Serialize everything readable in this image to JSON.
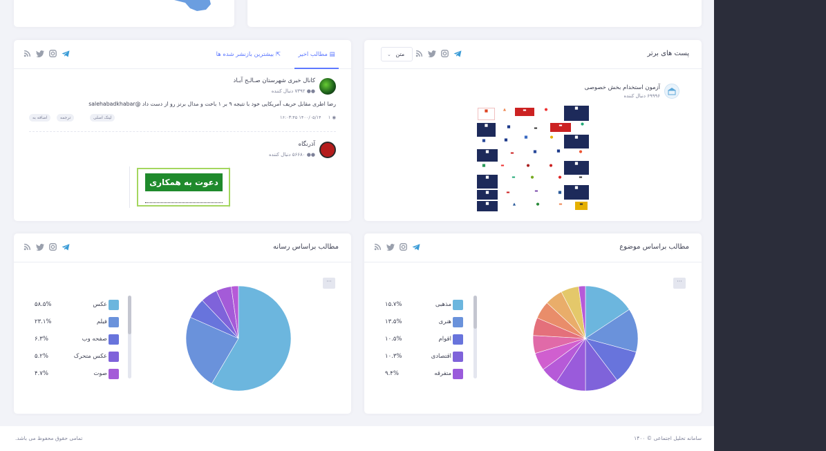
{
  "top_posts": {
    "title": "پست های برتر",
    "type_select": "متن",
    "channel_name": "آزمون استخدام بخش خصوصی",
    "followers": "۶۹۹۹۶ دنبال کننده"
  },
  "feed": {
    "tabs": [
      "مطالب اخیر",
      "بیشترین بازنشر شده ها"
    ],
    "posts": [
      {
        "channel": "کانال خبری شهرستان صـالـح آبـاد",
        "followers": "۷۳۹۲ دنبال کننده",
        "text": "رضا اطری مقابل حریف آمریکایی خود با نتیجه ۹ بر ۱ باخت و مدال برنز رو از دست داد @salehabadkhabar",
        "meta": "۱۴۰۰/۰۵/۱۴ ۱۶:۰۳:۴۵",
        "views": "۱",
        "tags": [
          "لینک اصلی",
          "ترجمه",
          "اضافه به"
        ]
      },
      {
        "channel": "آذرنگاه",
        "followers": "۵۶۶۸۰ دنبال کننده",
        "image_text": "دعوت به همکاری"
      }
    ]
  },
  "by_topic": {
    "title": "مطالب براساس موضوع",
    "menu": "···",
    "legend": [
      {
        "label": "مذهبی",
        "value": "۱۵.۷%",
        "color": "#6cb6de"
      },
      {
        "label": "هنری",
        "value": "۱۳.۵%",
        "color": "#6a92db"
      },
      {
        "label": "اقوام",
        "value": "۱۰.۵%",
        "color": "#6874dc"
      },
      {
        "label": "اقتصادی",
        "value": "۱۰.۳%",
        "color": "#7f63da"
      },
      {
        "label": "متفرقه",
        "value": "۹.۴%",
        "color": "#9a5bdb"
      }
    ]
  },
  "by_media": {
    "title": "مطالب براساس رسانه",
    "menu": "···",
    "legend": [
      {
        "label": "عکس",
        "value": "۵۸.۵%",
        "color": "#6cb6de"
      },
      {
        "label": "فیلم",
        "value": "۲۳.۱%",
        "color": "#6a92db"
      },
      {
        "label": "صفحه وب",
        "value": "۶.۳%",
        "color": "#6874dc"
      },
      {
        "label": "عکس متحرک",
        "value": "۵.۲%",
        "color": "#7f63da"
      },
      {
        "label": "صوت",
        "value": "۴.۷%",
        "color": "#a45bd8"
      }
    ]
  },
  "footer": {
    "right": "سامانه تحلیل اجتماعی © ۱۴۰۰",
    "left": "تمامی حقوق محفوظ می باشد."
  },
  "chart_data": [
    {
      "type": "pie",
      "title": "مطالب براساس موضوع",
      "categories": [
        "مذهبی",
        "هنری",
        "اقوام",
        "اقتصادی",
        "متفرقه"
      ],
      "values": [
        15.7,
        13.5,
        10.5,
        10.3,
        9.4
      ],
      "legend": "left"
    },
    {
      "type": "pie",
      "title": "مطالب براساس رسانه",
      "categories": [
        "عکس",
        "فیلم",
        "صفحه وب",
        "عکس متحرک",
        "صوت"
      ],
      "values": [
        58.5,
        23.1,
        6.3,
        5.2,
        4.7
      ],
      "legend": "left"
    }
  ]
}
